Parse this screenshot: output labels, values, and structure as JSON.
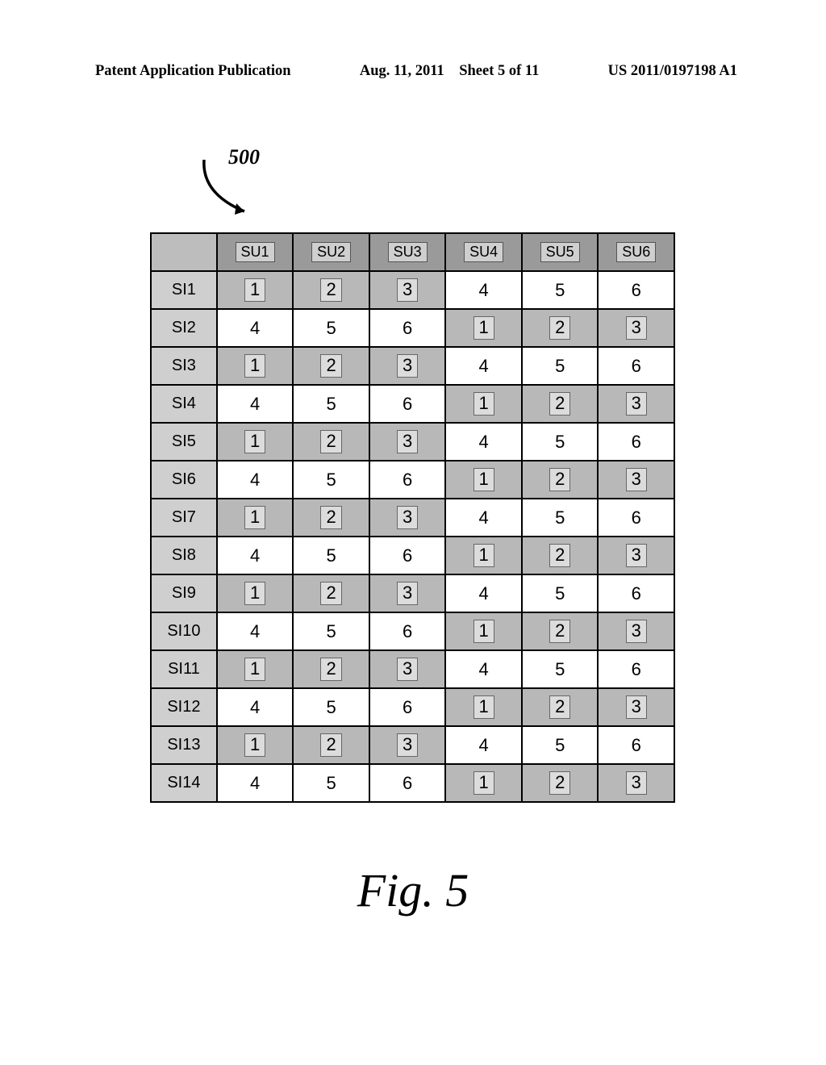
{
  "header": {
    "left": "Patent Application Publication",
    "mid_date": "Aug. 11, 2011",
    "mid_sheet": "Sheet 5 of 11",
    "right": "US 2011/0197198 A1"
  },
  "ref_num": "500",
  "table": {
    "col_headers": [
      "SU1",
      "SU2",
      "SU3",
      "SU4",
      "SU5",
      "SU6"
    ],
    "row_headers": [
      "SI1",
      "SI2",
      "SI3",
      "SI4",
      "SI5",
      "SI6",
      "SI7",
      "SI8",
      "SI9",
      "SI10",
      "SI11",
      "SI12",
      "SI13",
      "SI14"
    ],
    "rows": [
      {
        "vals": [
          "1",
          "2",
          "3",
          "4",
          "5",
          "6"
        ],
        "shade": [
          true,
          true,
          true,
          false,
          false,
          false
        ]
      },
      {
        "vals": [
          "4",
          "5",
          "6",
          "1",
          "2",
          "3"
        ],
        "shade": [
          false,
          false,
          false,
          true,
          true,
          true
        ]
      },
      {
        "vals": [
          "1",
          "2",
          "3",
          "4",
          "5",
          "6"
        ],
        "shade": [
          true,
          true,
          true,
          false,
          false,
          false
        ]
      },
      {
        "vals": [
          "4",
          "5",
          "6",
          "1",
          "2",
          "3"
        ],
        "shade": [
          false,
          false,
          false,
          true,
          true,
          true
        ]
      },
      {
        "vals": [
          "1",
          "2",
          "3",
          "4",
          "5",
          "6"
        ],
        "shade": [
          true,
          true,
          true,
          false,
          false,
          false
        ]
      },
      {
        "vals": [
          "4",
          "5",
          "6",
          "1",
          "2",
          "3"
        ],
        "shade": [
          false,
          false,
          false,
          true,
          true,
          true
        ]
      },
      {
        "vals": [
          "1",
          "2",
          "3",
          "4",
          "5",
          "6"
        ],
        "shade": [
          true,
          true,
          true,
          false,
          false,
          false
        ]
      },
      {
        "vals": [
          "4",
          "5",
          "6",
          "1",
          "2",
          "3"
        ],
        "shade": [
          false,
          false,
          false,
          true,
          true,
          true
        ]
      },
      {
        "vals": [
          "1",
          "2",
          "3",
          "4",
          "5",
          "6"
        ],
        "shade": [
          true,
          true,
          true,
          false,
          false,
          false
        ]
      },
      {
        "vals": [
          "4",
          "5",
          "6",
          "1",
          "2",
          "3"
        ],
        "shade": [
          false,
          false,
          false,
          true,
          true,
          true
        ]
      },
      {
        "vals": [
          "1",
          "2",
          "3",
          "4",
          "5",
          "6"
        ],
        "shade": [
          true,
          true,
          true,
          false,
          false,
          false
        ]
      },
      {
        "vals": [
          "4",
          "5",
          "6",
          "1",
          "2",
          "3"
        ],
        "shade": [
          false,
          false,
          false,
          true,
          true,
          true
        ]
      },
      {
        "vals": [
          "1",
          "2",
          "3",
          "4",
          "5",
          "6"
        ],
        "shade": [
          true,
          true,
          true,
          false,
          false,
          false
        ]
      },
      {
        "vals": [
          "4",
          "5",
          "6",
          "1",
          "2",
          "3"
        ],
        "shade": [
          false,
          false,
          false,
          true,
          true,
          true
        ]
      }
    ]
  },
  "fig_caption": "Fig. 5"
}
